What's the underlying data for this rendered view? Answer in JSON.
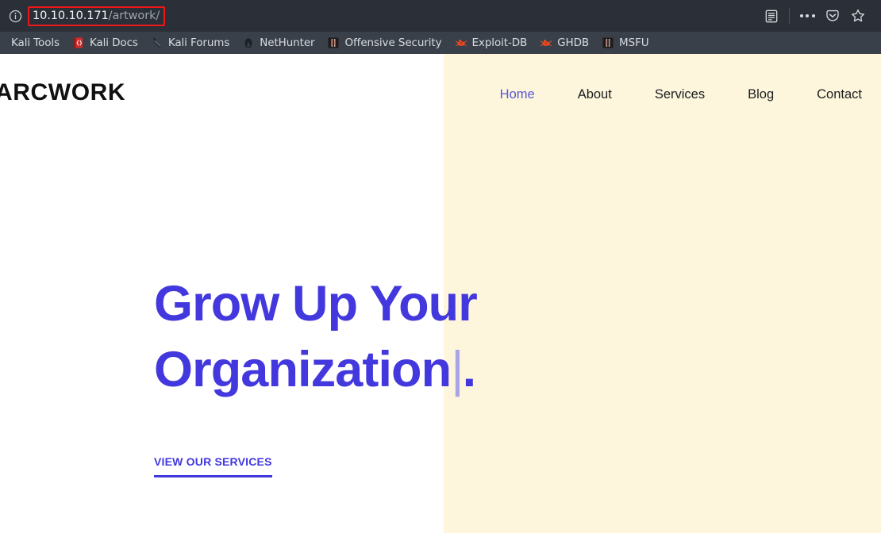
{
  "browser": {
    "identity_icon": "info-circle-icon",
    "url": {
      "host": "10.10.10.171",
      "path": "/artwork/",
      "full": "10.10.10.171/artwork/",
      "highlight_color": "#f01616"
    },
    "toolbar_buttons": [
      {
        "name": "reader-view-icon",
        "label": "Reader View"
      },
      {
        "name": "more-options-icon",
        "label": "Open application menu"
      },
      {
        "name": "pocket-icon",
        "label": "Save to Pocket"
      },
      {
        "name": "bookmark-star-icon",
        "label": "Bookmark this page"
      }
    ],
    "bookmarks": [
      {
        "label": "Kali Tools",
        "icon": "kali-tools-icon"
      },
      {
        "label": "Kali Docs",
        "icon": "kali-docs-book-icon"
      },
      {
        "label": "Kali Forums",
        "icon": "kali-forums-wrench-icon"
      },
      {
        "label": "NetHunter",
        "icon": "nethunter-icon"
      },
      {
        "label": "Offensive Security",
        "icon": "offensive-security-icon"
      },
      {
        "label": "Exploit-DB",
        "icon": "exploit-db-bug-icon"
      },
      {
        "label": "GHDB",
        "icon": "ghdb-bug-icon"
      },
      {
        "label": "MSFU",
        "icon": "msfu-icon"
      }
    ]
  },
  "site": {
    "brand": "ARCWORK",
    "nav": [
      {
        "label": "Home",
        "active": true
      },
      {
        "label": "About",
        "active": false
      },
      {
        "label": "Services",
        "active": false
      },
      {
        "label": "Blog",
        "active": false
      },
      {
        "label": "Contact",
        "active": false
      }
    ],
    "hero": {
      "line1": "Grow Up Your",
      "line2": "Organization",
      "caret": "|",
      "period": ".",
      "cta_label": "VIEW OUR SERVICES"
    },
    "colors": {
      "accent": "#4338dd",
      "nav_active": "#5856d6",
      "panel_left": "#ffffff",
      "panel_right": "#fdf6dd",
      "caret": "#a9a3e8"
    }
  }
}
